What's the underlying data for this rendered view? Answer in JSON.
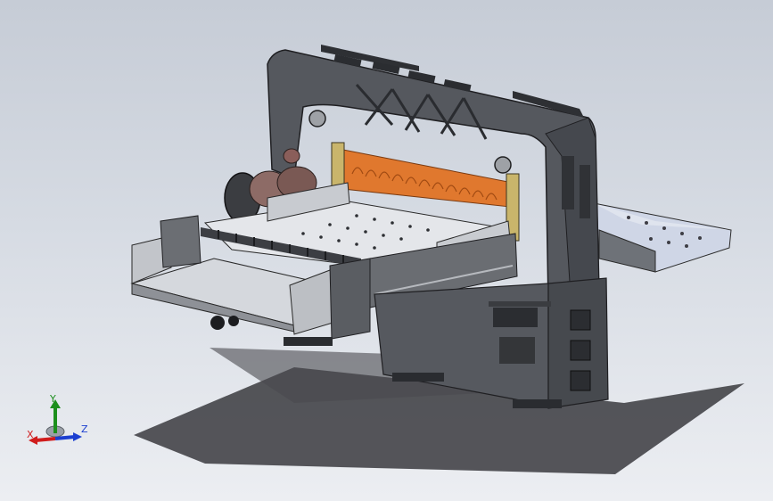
{
  "colors": {
    "background_top": "#c6ccd6",
    "background_bottom": "#eceef2",
    "frame": "#4f5257",
    "frame_dark": "#2e3034",
    "blade": "#e0782e",
    "table_surface": "#d8dade",
    "axis_x": "#d01c1c",
    "axis_y": "#1c8f1c",
    "axis_z": "#1c3fd0"
  },
  "scene": {
    "model": "paper-cutting-machine-3d-model",
    "icons": [
      "triad-icon"
    ]
  },
  "triad": {
    "x_label": "X",
    "y_label": "Y",
    "z_label": "Z"
  }
}
